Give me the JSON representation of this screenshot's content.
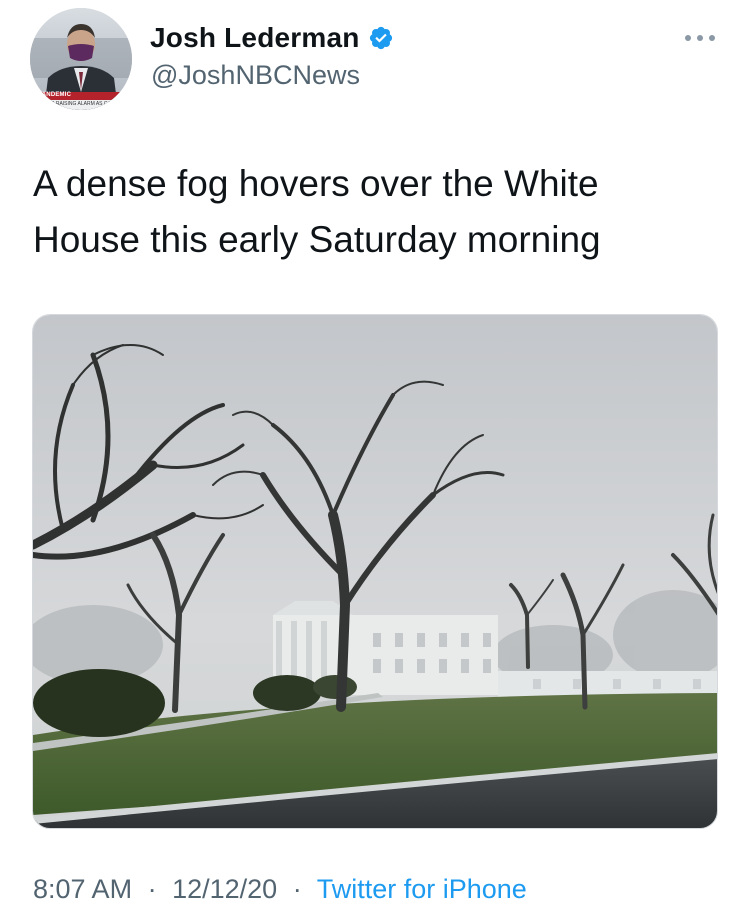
{
  "author": {
    "display_name": "Josh Lederman",
    "handle": "@JoshNBCNews",
    "verified": true,
    "avatar_badge_text": "PANDEMIC",
    "avatar_ticker_text": "RIALS RAISING ALARM AS CA"
  },
  "tweet": {
    "text": "A dense fog hovers over the White House this early Saturday morning"
  },
  "meta": {
    "time": "8:07 AM",
    "date": "12/12/20",
    "separator": "·",
    "source": "Twitter for iPhone"
  },
  "colors": {
    "text": "#0f1419",
    "secondary": "#536471",
    "link": "#1d9bf0",
    "verified_badge": "#1d9bf0"
  },
  "icons": {
    "verified": "verified-badge-icon",
    "more": "more-horizontal-icon"
  }
}
